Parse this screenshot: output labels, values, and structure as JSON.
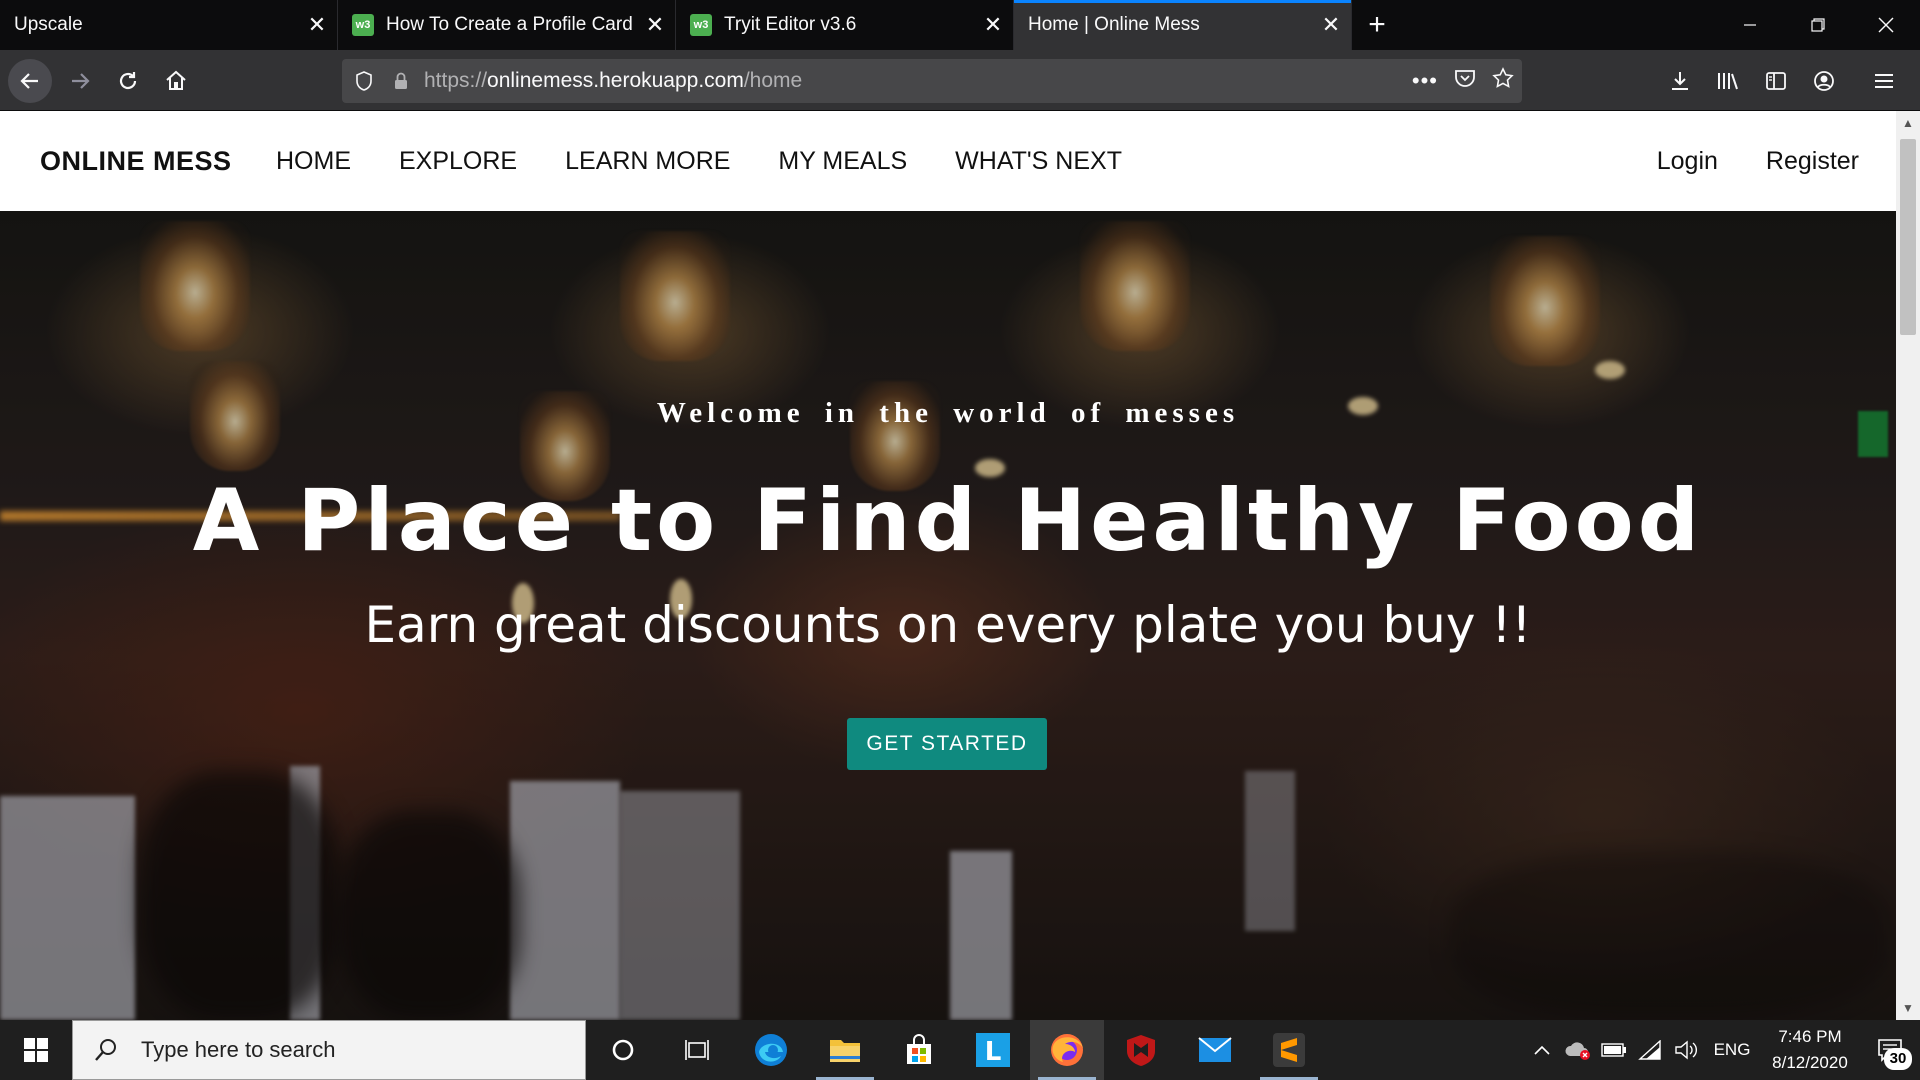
{
  "browser": {
    "tabs": [
      {
        "title": "Upscale",
        "favicon": false
      },
      {
        "title": "How To Create a Profile Card",
        "favicon": true,
        "favicon_text": "w3"
      },
      {
        "title": "Tryit Editor v3.6",
        "favicon": true,
        "favicon_text": "w3"
      },
      {
        "title": "Home | Online Mess",
        "favicon": false,
        "active": true
      }
    ],
    "url": {
      "prefix": "https://",
      "host": "onlinemess.herokuapp.com",
      "path": "/home"
    },
    "accent_color": "#0a84ff"
  },
  "site": {
    "brand": "ONLINE MESS",
    "nav": [
      "HOME",
      "EXPLORE",
      "LEARN MORE",
      "MY MEALS",
      "WHAT'S NEXT"
    ],
    "auth": {
      "login": "Login",
      "register": "Register"
    },
    "hero": {
      "kicker": "Welcome in the world of messes",
      "title": "A Place to Find Healthy Food",
      "subtitle": "Earn great discounts on every plate you buy !!",
      "cta": "GET STARTED",
      "cta_color": "#0f8a7f"
    }
  },
  "taskbar": {
    "search_placeholder": "Type here to search",
    "apps": [
      "cortana-icon",
      "task-view-icon",
      "edge-icon",
      "file-explorer-icon",
      "store-icon",
      "l-app-icon",
      "firefox-icon",
      "mcafee-icon",
      "mail-icon",
      "sublime-text-icon"
    ],
    "language": "ENG",
    "time": "7:46 PM",
    "date": "8/12/2020",
    "notification_count": "30"
  }
}
